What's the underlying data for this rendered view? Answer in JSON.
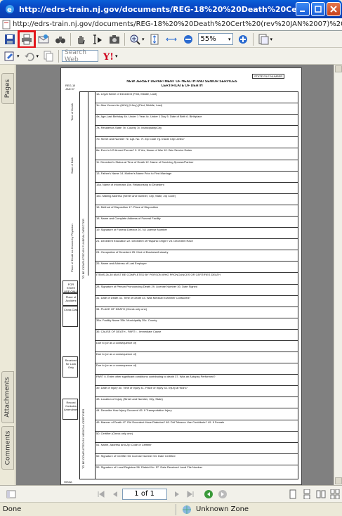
{
  "window": {
    "title": "http://edrs-train.nj.gov/documents/REG-18%20%20Death%20Cert%20(rev%20JA..."
  },
  "address_bar": {
    "url": "http://edrs-train.nj.gov/documents/REG-18%20%20Death%20Cert%20(rev%20JAN%2007)%20Pg.%201%20Or"
  },
  "toolbar": {
    "zoom_value": "55%",
    "search_placeholder": "Search Web"
  },
  "sidebar": {
    "tabs": [
      "Pages",
      "Attachments",
      "Comments"
    ]
  },
  "navigation": {
    "page_indicator": "1 of 1"
  },
  "status": {
    "left": "Done",
    "zone": "Unknown Zone"
  },
  "form": {
    "header_code": "REG-18",
    "header_date": "JAN 07",
    "state_file_label": "STATE FILE NUMBER",
    "dept": "NEW JERSEY DEPARTMENT OF HEALTH AND SENIOR SERVICES",
    "doc_title": "CERTIFICATE OF DEATH",
    "side_label_top": "TO BE COMPLETED BY FUNERAL DIRECTOR",
    "side_label_bottom": "TO BE COMPLETED BY MEDICAL CERTIFIER",
    "time_of_death": "Time of Death",
    "state_of_birth": "State of Birth",
    "place_of_death": "Place of Death As Known by Physician",
    "for_state_use": "FOR STATE USE ONLY",
    "place_of_accident": "Place of Accident",
    "cross_class": "Cross Class",
    "received_for_lock": "Received for Lock Only",
    "record_contains": "Record Contains Amendment",
    "footer_code": "HIS3A",
    "rows": [
      "1a. Legal Name of Decedent (First, Middle, Last)",
      "1b. Also Known As (AKA) (If Any) (First, Middle, Last)",
      "4a. Age-Last Birthday   4b. Under 1 Year   4c. Under 1 Day   5. Date of Birth   6. Birthplace",
      "7a. Residence-State   7b. County   7c. Municipality/City",
      "7d. Street and Number   7e. Apt. No.   7f. Zip Code   7g. Inside City Limits?",
      "8a. Ever in US Armed Forces?   9. If Yes, Name of War   10. War Service Dates",
      "11. Decedent's Status at Time of Death   12. Name of Surviving Spouse/Partner",
      "13. Father's Name   14. Mother's Name Prior to First Marriage",
      "15a. Name of Informant   15b. Relationship to Decedent",
      "15c. Mailing Address (Street and Number, City, State, Zip Code)",
      "16. Method of Disposition   17. Place of Disposition",
      "18. Name and Complete Address of Funeral Facility",
      "19. Signature of Funeral Director   20. NJ License Number",
      "21. Decedent Education   22. Decedent of Hispanic Origin?   23. Decedent Race",
      "24. Occupation of Decedent   25. Kind of Business/Industry",
      "26. Name and Address of Last Employer",
      "ITEMS 26-30 MUST BE COMPLETED BY PERSON WHO PRONOUNCES OR CERTIFIES DEATH",
      "28. Signature of Person Pronouncing Death   29. License Number   30. Date Signed",
      "31. Date of Death   32. Time of Death   33. Was Medical Examiner Contacted?",
      "34. PLACE OF DEATH (Check only one)",
      "35a. Facility Name   35b. Municipality   35c. County",
      "36. CAUSE OF DEATH - PART I - Immediate Cause",
      "Due to (or as a consequence of)",
      "Due to (or as a consequence of)",
      "Due to (or as a consequence of)",
      "PART II. Enter other significant conditions contributing to death   37. Was an Autopsy Performed?",
      "39. Date of Injury   40. Time of Injury   41. Place of Injury   42. Injury at Work?",
      "43. Location of Injury (Street and Number, City, State)",
      "44. Describe How Injury Occurred   45. If Transportation Injury",
      "46. Manner of Death   47. Did Decedent Have Diabetes?   48. Did Tobacco Use Contribute?   49. If Female",
      "50. Certifier (Check only one)",
      "51. Name, Address and Zip Code of Certifier",
      "52. Signature of Certifier   53. License Number   54. Date Certified",
      "55. Signature of Local Registrar   56. District No.   57. Date Received   Local File Number"
    ]
  }
}
